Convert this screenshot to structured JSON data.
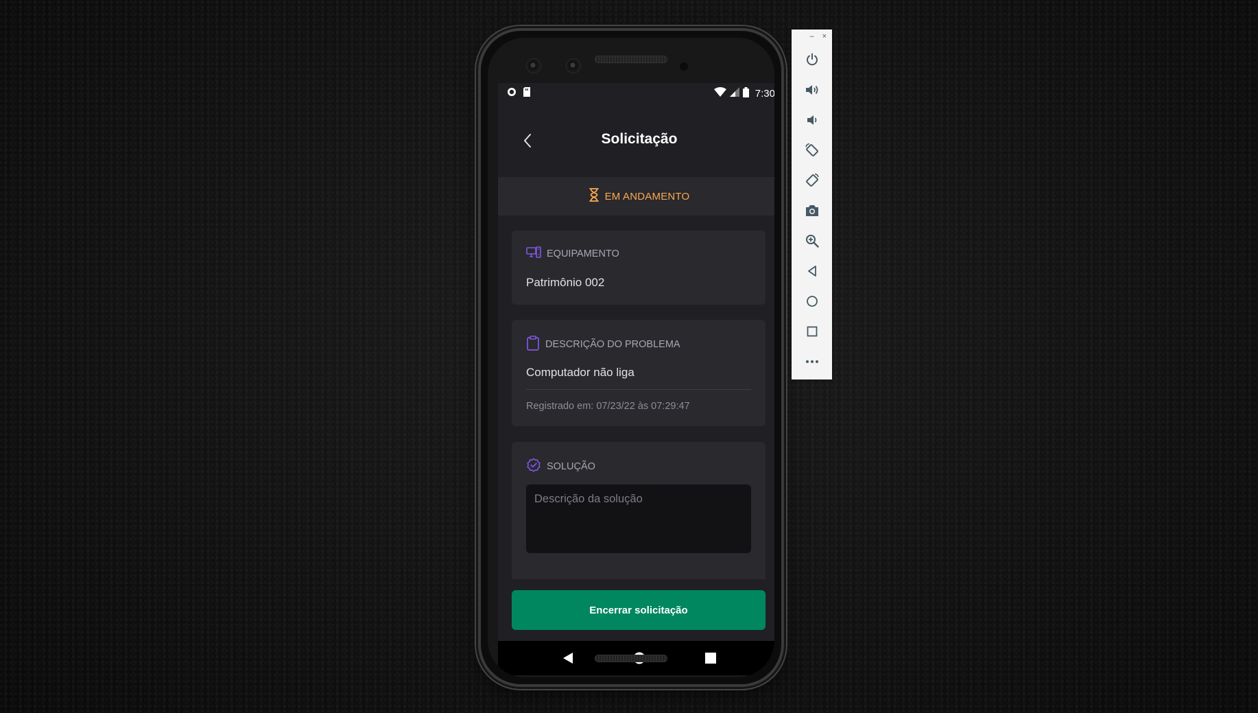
{
  "status_bar": {
    "time": "7:30",
    "left_icons": [
      "record-icon",
      "sd-card-icon"
    ],
    "right_icons": [
      "wifi-icon",
      "signal-icon",
      "battery-icon"
    ]
  },
  "header": {
    "title": "Solicitação"
  },
  "status_banner": {
    "label": "EM ANDAMENTO",
    "icon": "hourglass-icon",
    "color": "#fba94c"
  },
  "cards": {
    "equipment": {
      "heading": "EQUIPAMENTO",
      "icon": "desktop-device-icon",
      "value": "Patrimônio 002"
    },
    "problem": {
      "heading": "DESCRIÇÃO DO PROBLEMA",
      "icon": "clipboard-icon",
      "value": "Computador não liga",
      "registered": "Registrado em: 07/23/22 às 07:29:47"
    },
    "solution": {
      "heading": "SOLUÇÃO",
      "icon": "verified-badge-icon",
      "placeholder": "Descrição da solução"
    }
  },
  "footer": {
    "button_label": "Encerrar solicitação",
    "button_color": "#00875f"
  },
  "accent_color": "#8257e5",
  "android_nav": [
    "back",
    "home",
    "recents"
  ],
  "emulator_panel": {
    "window_controls": [
      "–",
      "×"
    ],
    "buttons": [
      "power",
      "volume-up",
      "volume-down",
      "rotate-left",
      "rotate-right",
      "screenshot",
      "zoom",
      "back",
      "home",
      "overview",
      "more"
    ]
  }
}
